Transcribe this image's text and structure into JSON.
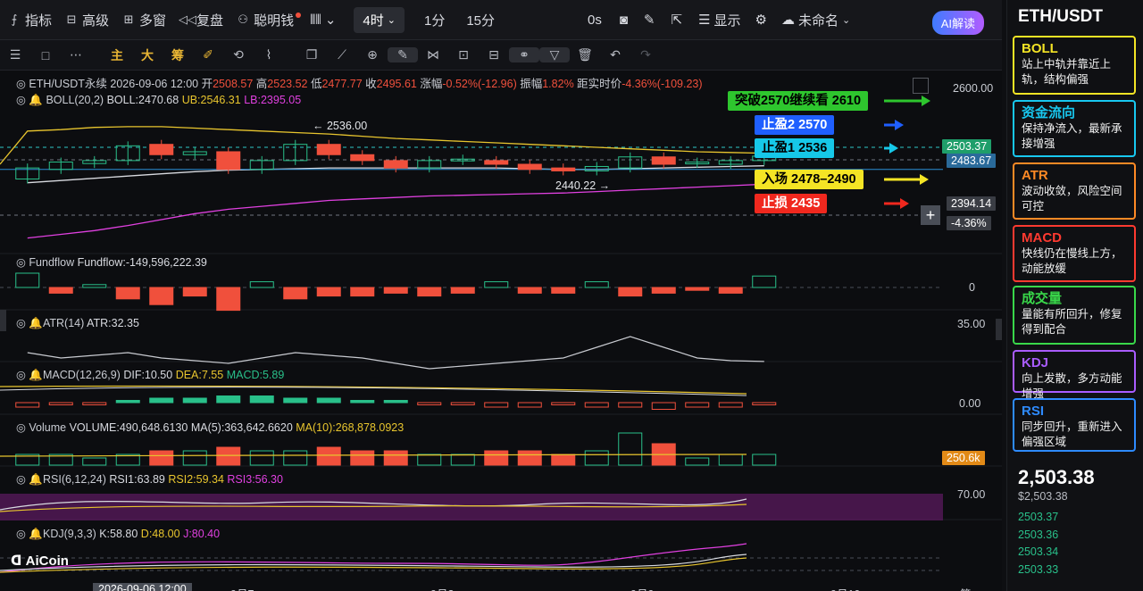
{
  "topbar": {
    "items": [
      {
        "icon": "indicator-icon",
        "label": "指标"
      },
      {
        "icon": "advanced-icon",
        "label": "高级"
      },
      {
        "icon": "multiwindow-icon",
        "label": "多窗"
      },
      {
        "icon": "replay-icon",
        "label": "复盘"
      },
      {
        "icon": "smartmoney-icon",
        "label": "聪明钱"
      }
    ],
    "interval": "4时",
    "intervals": [
      "1分",
      "15分"
    ],
    "countdown": "0s",
    "display_label": "显示",
    "workspace": "未命名",
    "ai_label": "AI解读"
  },
  "toolbar": {
    "main": "主",
    "big": "大",
    "chip": "筹"
  },
  "main_chart": {
    "symbol": "ETH/USDT永续",
    "datetime": "2026-09-06 12:00",
    "open_label": "开",
    "open": "2508.57",
    "high_label": "高",
    "high": "2523.52",
    "low_label": "低",
    "low": "2477.77",
    "close_label": "收",
    "close": "2495.61",
    "change_label": "涨幅",
    "change": "-0.52%(-12.96)",
    "amp_label": "振幅",
    "amp": "1.82%",
    "dist_label": "距实时价",
    "dist": "-4.36%(-109.23)",
    "boll_label": "BOLL(20,2)",
    "boll_mid": "BOLL:2470.68",
    "boll_ub": "UB:2546.31",
    "boll_lb": "LB:2395.05",
    "high_mark": "← 2536.00",
    "low_mark": "2440.22 →",
    "price_top": "2600.00",
    "price_cur": "2503.37",
    "price_ub": "2483.67",
    "price_lo": "2394.14",
    "price_pct": "-4.36%"
  },
  "annotations": [
    {
      "text": "突破2570继续看 2610",
      "bg": "#2ec62e",
      "fg": "#000000"
    },
    {
      "text": "止盈2 2570",
      "bg": "#1f5fff",
      "fg": "#ffffff"
    },
    {
      "text": "止盈1 2536",
      "bg": "#16c8e8",
      "fg": "#000000"
    },
    {
      "text": "入场 2478–2490",
      "bg": "#f4e425",
      "fg": "#000000"
    },
    {
      "text": "止损 2435",
      "bg": "#f0281e",
      "fg": "#ffffff"
    }
  ],
  "panels": {
    "fundflow": {
      "name": "Fundflow",
      "value": "Fundflow:-149,596,222.39",
      "axis": "0"
    },
    "atr": {
      "name": "ATR(14)",
      "value": "ATR:32.35",
      "axis": "35.00"
    },
    "macd": {
      "name": "MACD(12,26,9)",
      "dif": "DIF:10.50",
      "dea": "DEA:7.55",
      "macd": "MACD:5.89",
      "axis": "0.00"
    },
    "volume": {
      "name": "Volume",
      "value": "VOLUME:490,648.6130",
      "ma5": "MA(5):363,642.6620",
      "ma10": "MA(10):268,878.0923",
      "axis": "250.6k"
    },
    "rsi": {
      "name": "RSI(6,12,24)",
      "rsi1": "RSI1:63.89",
      "rsi2": "RSI2:59.34",
      "rsi3": "RSI3:56.30",
      "axis": "70.00"
    },
    "kdj": {
      "name": "KDJ(9,3,3)",
      "k": "K:58.80",
      "d": "D:48.00",
      "j": "J:80.40"
    }
  },
  "xaxis": {
    "start": "2026-09-06 12:00",
    "t1": "9月7",
    "t2": "9月8",
    "t3": "9月9",
    "t4": "9月10",
    "t5": "简"
  },
  "logo": "AiCoin",
  "right_panel": {
    "title": "ETH/USDT",
    "cards": [
      {
        "head": "BOLL",
        "body": "站上中轨并靠近上轨，结构偏强",
        "color": "#f4e425"
      },
      {
        "head": "资金流向",
        "body": "保持净流入，最新承接增强",
        "color": "#18c8f0"
      },
      {
        "head": "ATR",
        "body": "波动收敛，风险空间可控",
        "color": "#ff8a25"
      },
      {
        "head": "MACD",
        "body": "快线仍在慢线上方，动能放缓",
        "color": "#ff3a30"
      },
      {
        "head": "成交量",
        "body": "量能有所回升，修复得到配合",
        "color": "#39d84a"
      },
      {
        "head": "KDJ",
        "body": "向上发散，多方动能增强",
        "color": "#a95cff"
      },
      {
        "head": "RSI",
        "body": "同步回升，重新进入偏强区域",
        "color": "#2e8bff"
      }
    ],
    "price": "2,503.38",
    "price_sub": "$2,503.38",
    "orderbook": [
      "2503.37",
      "2503.36",
      "2503.34",
      "2503.33"
    ]
  },
  "chart_data": {
    "type": "candlestick",
    "title": "ETH/USDT永续 4H",
    "candles": [
      {
        "o": 2475,
        "c": 2490
      },
      {
        "o": 2488,
        "c": 2498
      },
      {
        "o": 2496,
        "c": 2500
      },
      {
        "o": 2500,
        "c": 2520
      },
      {
        "o": 2522,
        "c": 2508
      },
      {
        "o": 2508,
        "c": 2512
      },
      {
        "o": 2512,
        "c": 2488
      },
      {
        "o": 2488,
        "c": 2500
      },
      {
        "o": 2500,
        "c": 2522
      },
      {
        "o": 2522,
        "c": 2508
      },
      {
        "o": 2508,
        "c": 2500
      },
      {
        "o": 2500,
        "c": 2490
      },
      {
        "o": 2490,
        "c": 2500
      },
      {
        "o": 2500,
        "c": 2502
      },
      {
        "o": 2500,
        "c": 2495
      },
      {
        "o": 2495,
        "c": 2488
      },
      {
        "o": 2490,
        "c": 2486
      },
      {
        "o": 2486,
        "c": 2492
      },
      {
        "o": 2490,
        "c": 2505
      },
      {
        "o": 2505,
        "c": 2495
      },
      {
        "o": 2496,
        "c": 2498
      },
      {
        "o": 2495,
        "c": 2500
      },
      {
        "o": 2500,
        "c": 2506
      }
    ],
    "boll_ub": [
      2540,
      2542,
      2545,
      2546,
      2546,
      2544,
      2542,
      2540,
      2538,
      2536,
      2533,
      2530,
      2528,
      2526,
      2524,
      2522,
      2520,
      2518,
      2516,
      2514,
      2512,
      2511,
      2510
    ],
    "boll_mid": [
      2470,
      2473,
      2476,
      2479,
      2482,
      2485,
      2487,
      2488,
      2489,
      2490,
      2490,
      2490,
      2490,
      2490,
      2490,
      2489,
      2488,
      2488,
      2489,
      2490,
      2491,
      2492,
      2493
    ],
    "boll_lb": [
      2395,
      2400,
      2405,
      2412,
      2420,
      2428,
      2434,
      2438,
      2442,
      2446,
      2448,
      2450,
      2452,
      2453,
      2454,
      2455,
      2456,
      2458,
      2460,
      2462,
      2464,
      2466,
      2468
    ],
    "fundflow": [
      5,
      -2,
      1,
      -4,
      -6,
      -3,
      -8,
      2,
      -4,
      -3,
      -3,
      -2,
      -3,
      -2,
      2,
      -2,
      -2,
      2,
      -3,
      -2,
      -1,
      -2,
      4
    ],
    "atr": [
      34,
      33,
      33.5,
      34,
      33,
      32.5,
      32,
      33,
      34,
      33.5,
      33,
      32,
      31,
      31.5,
      32,
      32.5,
      33,
      35,
      37,
      35,
      33,
      32.5,
      32.35
    ],
    "macd": [
      -2,
      -1,
      -1,
      1,
      2,
      2,
      3,
      3,
      2,
      2,
      1,
      1,
      -1,
      -1,
      -2,
      -2,
      -1,
      -2,
      -2,
      -3,
      -2,
      -2,
      -1
    ],
    "volume": [
      3,
      3,
      2,
      3,
      4,
      4,
      5,
      4,
      4,
      5,
      4,
      4,
      3,
      3,
      4,
      4,
      3,
      4,
      9,
      6,
      2,
      3,
      3
    ],
    "ylim": [
      2380,
      2610
    ]
  }
}
